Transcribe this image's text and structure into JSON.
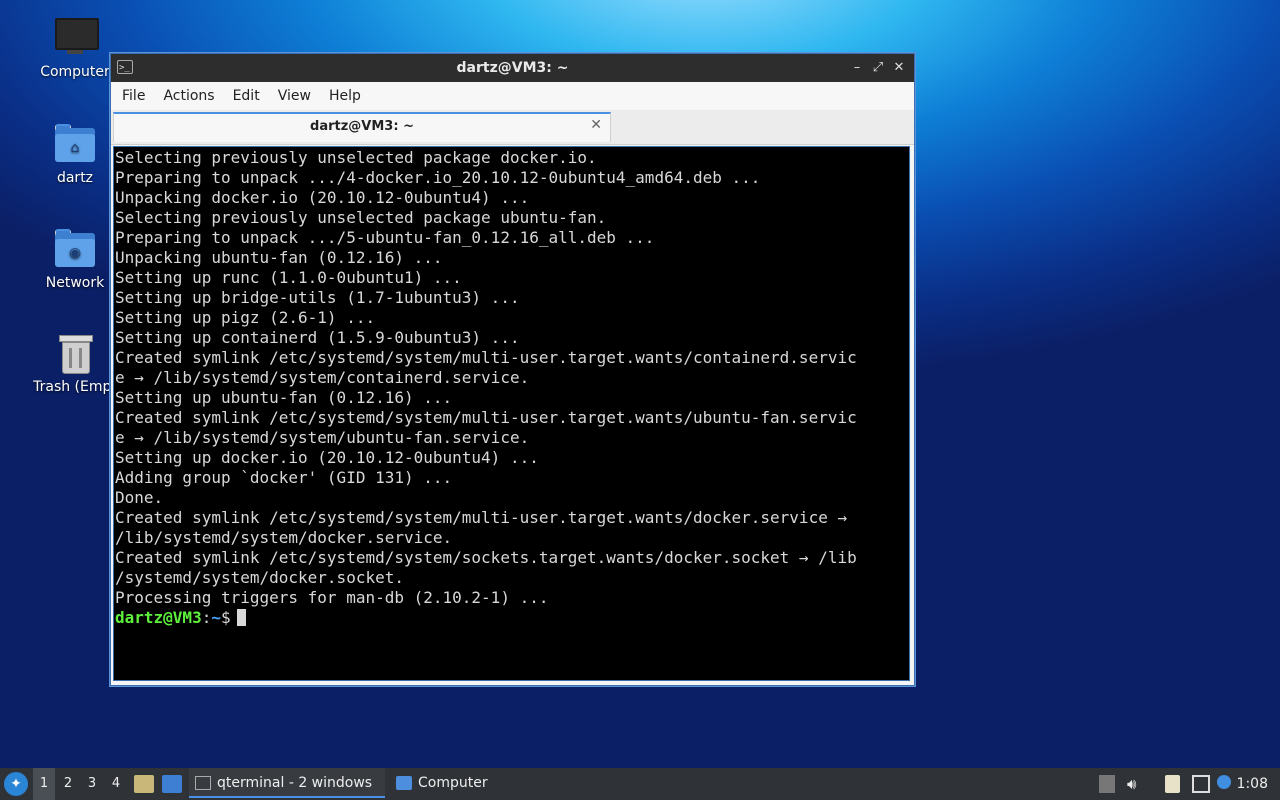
{
  "desktop": {
    "icons": [
      {
        "label": "Computer"
      },
      {
        "label": "dartz"
      },
      {
        "label": "Network"
      },
      {
        "label": "Trash (Empt"
      }
    ]
  },
  "window": {
    "title": "dartz@VM3: ~",
    "menu": [
      "File",
      "Actions",
      "Edit",
      "View",
      "Help"
    ],
    "tab_title": "dartz@VM3: ~",
    "terminal_lines": [
      "Selecting previously unselected package docker.io.",
      "Preparing to unpack .../4-docker.io_20.10.12-0ubuntu4_amd64.deb ...",
      "Unpacking docker.io (20.10.12-0ubuntu4) ...",
      "Selecting previously unselected package ubuntu-fan.",
      "Preparing to unpack .../5-ubuntu-fan_0.12.16_all.deb ...",
      "Unpacking ubuntu-fan (0.12.16) ...",
      "Setting up runc (1.1.0-0ubuntu1) ...",
      "Setting up bridge-utils (1.7-1ubuntu3) ...",
      "Setting up pigz (2.6-1) ...",
      "Setting up containerd (1.5.9-0ubuntu3) ...",
      "Created symlink /etc/systemd/system/multi-user.target.wants/containerd.servic",
      "e → /lib/systemd/system/containerd.service.",
      "Setting up ubuntu-fan (0.12.16) ...",
      "Created symlink /etc/systemd/system/multi-user.target.wants/ubuntu-fan.servic",
      "e → /lib/systemd/system/ubuntu-fan.service.",
      "Setting up docker.io (20.10.12-0ubuntu4) ...",
      "Adding group `docker' (GID 131) ...",
      "Done.",
      "Created symlink /etc/systemd/system/multi-user.target.wants/docker.service →",
      "/lib/systemd/system/docker.service.",
      "Created symlink /etc/systemd/system/sockets.target.wants/docker.socket → /lib",
      "/systemd/system/docker.socket.",
      "Processing triggers for man-db (2.10.2-1) ..."
    ],
    "prompt": {
      "user_host": "dartz@VM3",
      "sep": ":",
      "path": "~",
      "symbol": "$"
    }
  },
  "taskbar": {
    "workspaces": [
      "1",
      "2",
      "3",
      "4"
    ],
    "tasks": [
      {
        "label": "qterminal - 2 windows",
        "icon": "terminal-icon"
      },
      {
        "label": "Computer",
        "icon": "folder-icon"
      }
    ],
    "clock": "1:08"
  },
  "colors": {
    "prompt_user": "#5df03c",
    "prompt_path": "#4aa3ff",
    "accent": "#4a90e2"
  }
}
